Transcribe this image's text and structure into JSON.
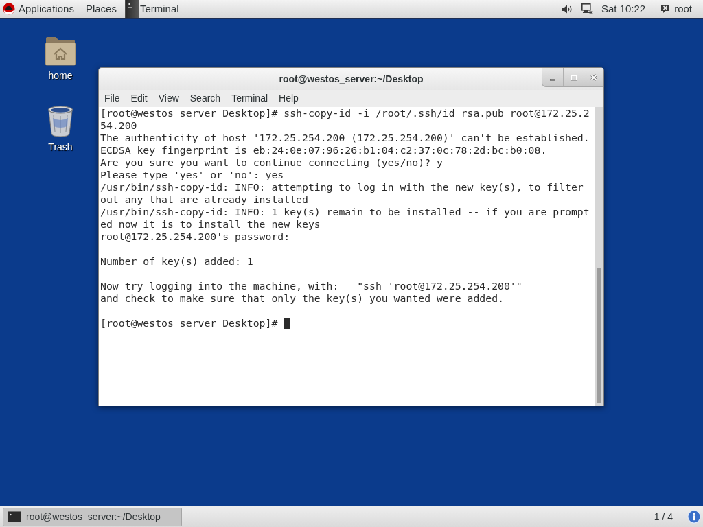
{
  "top_bar": {
    "menus": [
      {
        "label": "Applications"
      },
      {
        "label": "Places"
      }
    ],
    "app_menu": {
      "label": "Terminal"
    },
    "clock": "Sat 10:22",
    "user": "root"
  },
  "desktop_icons": [
    {
      "kind": "folder",
      "label": "home"
    },
    {
      "kind": "trash",
      "label": "Trash"
    }
  ],
  "terminal_window": {
    "title": "root@westos_server:~/Desktop",
    "menu": [
      "File",
      "Edit",
      "View",
      "Search",
      "Terminal",
      "Help"
    ],
    "output_blocks": [
      [
        "[root@westos_server Desktop]# ssh-copy-id -i /root/.ssh/id_rsa.pub root@172.25.2",
        "54.200",
        "The authenticity of host '172.25.254.200 (172.25.254.200)' can't be established.",
        "ECDSA key fingerprint is eb:24:0e:07:96:26:b1:04:c2:37:0c:78:2d:bc:b0:08.",
        "Are you sure you want to continue connecting (yes/no)? y",
        "Please type 'yes' or 'no': yes",
        "/usr/bin/ssh-copy-id: INFO: attempting to log in with the new key(s), to filter",
        "out any that are already installed",
        "/usr/bin/ssh-copy-id: INFO: 1 key(s) remain to be installed -- if you are prompt",
        "ed now it is to install the new keys",
        "root@172.25.254.200's password:"
      ],
      [
        "Number of key(s) added: 1"
      ],
      [
        "Now try logging into the machine, with:   \"ssh 'root@172.25.254.200'\"",
        "and check to make sure that only the key(s) you wanted were added."
      ]
    ],
    "prompt": "[root@westos_server Desktop]# "
  },
  "taskbar": {
    "windows": [
      {
        "label": "root@westos_server:~/Desktop",
        "selected": true
      }
    ],
    "workspace": "1 / 4"
  }
}
